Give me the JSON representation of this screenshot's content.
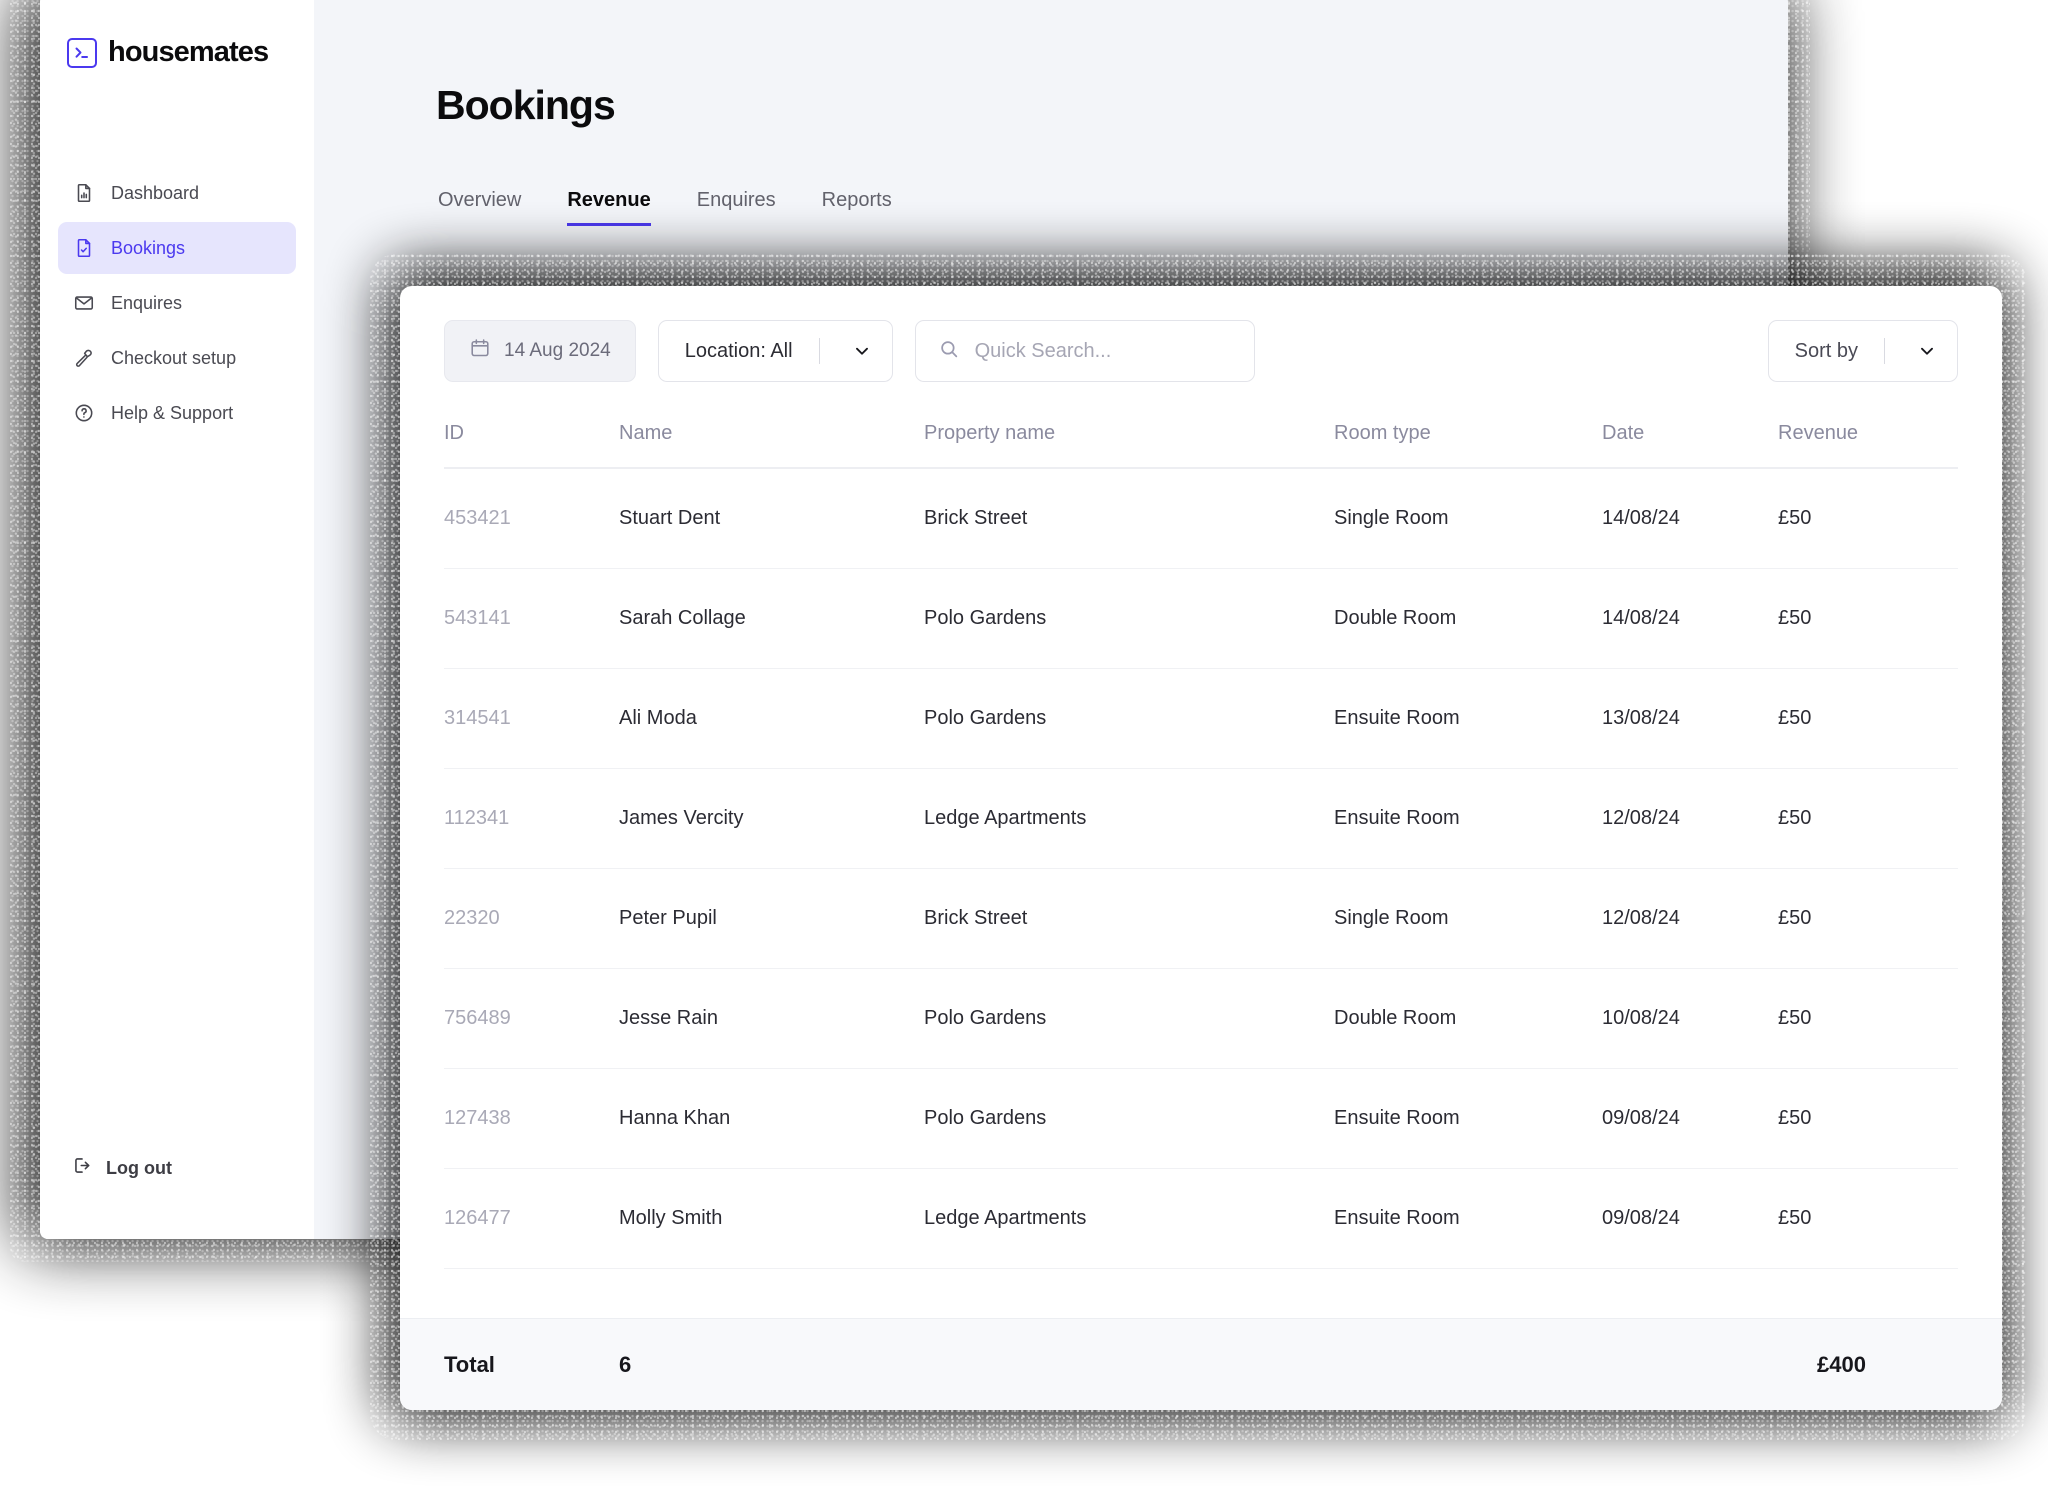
{
  "brand": {
    "name": "housemates",
    "logo_icon": "terminal-prompt-icon",
    "accent": "#4b39ef"
  },
  "sidebar": {
    "items": [
      {
        "label": "Dashboard",
        "icon": "document-chart-icon",
        "active": false
      },
      {
        "label": "Bookings",
        "icon": "document-check-icon",
        "active": true
      },
      {
        "label": "Enquires",
        "icon": "envelope-icon",
        "active": false
      },
      {
        "label": "Checkout setup",
        "icon": "hammer-icon",
        "active": false
      },
      {
        "label": "Help & Support",
        "icon": "question-circle-icon",
        "active": false
      }
    ],
    "logout": {
      "label": "Log out",
      "icon": "logout-icon"
    }
  },
  "header": {
    "title": "Bookings"
  },
  "tabs": [
    {
      "label": "Overview",
      "active": false
    },
    {
      "label": "Revenue",
      "active": true
    },
    {
      "label": "Enquires",
      "active": false
    },
    {
      "label": "Reports",
      "active": false
    }
  ],
  "toolbar": {
    "date": {
      "value": "14 Aug 2024",
      "icon": "calendar-icon"
    },
    "location": {
      "label": "Location: All",
      "icon": "chevron-down-icon"
    },
    "search": {
      "value": "",
      "placeholder": "Quick Search...",
      "icon": "search-icon"
    },
    "sort": {
      "label": "Sort by",
      "icon": "chevron-down-icon"
    }
  },
  "table": {
    "columns": [
      "ID",
      "Name",
      "Property name",
      "Room type",
      "Date",
      "Revenue"
    ],
    "rows": [
      {
        "id": "453421",
        "name": "Stuart Dent",
        "property": "Brick Street",
        "room": "Single Room",
        "date": "14/08/24",
        "revenue": "£50"
      },
      {
        "id": "543141",
        "name": "Sarah Collage",
        "property": "Polo Gardens",
        "room": "Double Room",
        "date": "14/08/24",
        "revenue": "£50"
      },
      {
        "id": "314541",
        "name": "Ali Moda",
        "property": "Polo Gardens",
        "room": "Ensuite Room",
        "date": "13/08/24",
        "revenue": "£50"
      },
      {
        "id": "112341",
        "name": "James Vercity",
        "property": "Ledge Apartments",
        "room": "Ensuite Room",
        "date": "12/08/24",
        "revenue": "£50"
      },
      {
        "id": "22320",
        "name": "Peter Pupil",
        "property": "Brick Street",
        "room": "Single Room",
        "date": "12/08/24",
        "revenue": "£50"
      },
      {
        "id": "756489",
        "name": "Jesse Rain",
        "property": "Polo Gardens",
        "room": "Double Room",
        "date": "10/08/24",
        "revenue": "£50"
      },
      {
        "id": "127438",
        "name": "Hanna Khan",
        "property": "Polo Gardens",
        "room": "Ensuite Room",
        "date": "09/08/24",
        "revenue": "£50"
      },
      {
        "id": "126477",
        "name": "Molly Smith",
        "property": "Ledge Apartments",
        "room": "Ensuite Room",
        "date": "09/08/24",
        "revenue": "£50"
      }
    ],
    "footer": {
      "label": "Total",
      "count": "6",
      "sum": "£400"
    }
  }
}
